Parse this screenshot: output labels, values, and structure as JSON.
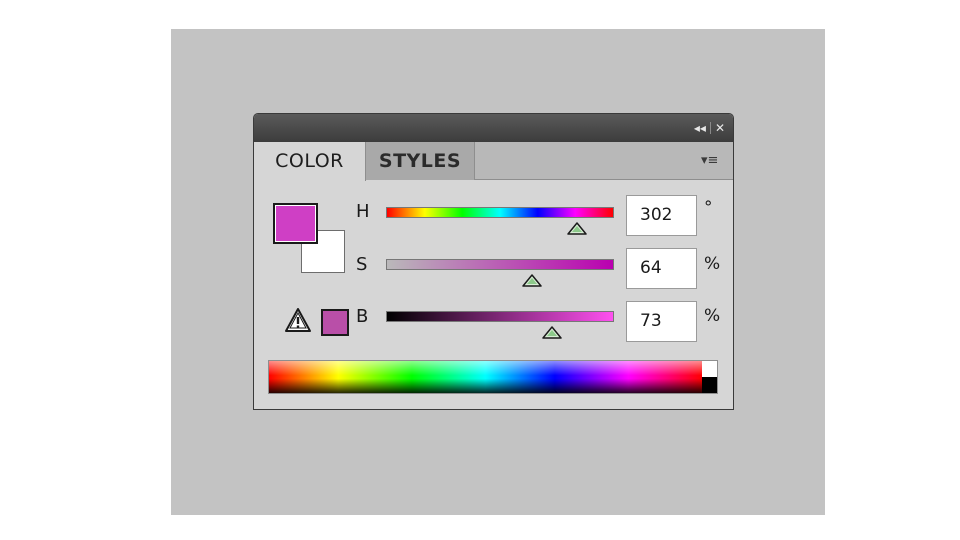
{
  "panel": {
    "collapse_icon": "double-chevron-left-icon",
    "close_icon": "close-icon",
    "collapse_glyph": "◂◂",
    "close_glyph": "✕"
  },
  "tabs": [
    {
      "label": "COLOR",
      "active": true
    },
    {
      "label": "STYLES",
      "active": false
    }
  ],
  "menu_icon": "panel-menu-icon",
  "menu_glyph": "▾≡",
  "swatches": {
    "foreground": "#cf3fc5",
    "background": "#ffffff",
    "gamut_warning_color": "#b94fa8",
    "warning_icon": "warning-triangle-icon"
  },
  "channels": [
    {
      "label": "H",
      "value": "302",
      "unit": "°",
      "level": 0.839
    },
    {
      "label": "S",
      "value": "64",
      "unit": "%",
      "level": 0.64
    },
    {
      "label": "B",
      "value": "73",
      "unit": "%",
      "level": 0.73
    }
  ]
}
